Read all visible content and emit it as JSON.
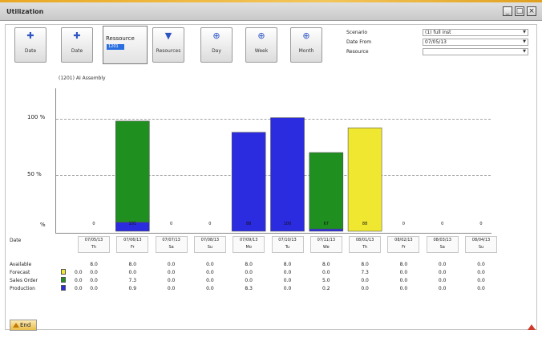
{
  "window": {
    "title": "Utilization",
    "minimize_label": "_",
    "maximize_label": "□",
    "close_label": "×"
  },
  "toolbar": {
    "buttons": [
      {
        "label": "Date",
        "icon": "arrow-up-icon"
      },
      {
        "label": "Date",
        "icon": "arrow-down-icon"
      },
      {
        "label": "Resources",
        "icon": "filter-icon"
      },
      {
        "label": "Day",
        "icon": "zoom-icon"
      },
      {
        "label": "Week",
        "icon": "zoom-icon"
      },
      {
        "label": "Month",
        "icon": "zoom-icon"
      }
    ],
    "resource_button": {
      "label": "Ressource",
      "selected": "1201"
    }
  },
  "params": {
    "scenario": {
      "label": "Scenario",
      "value": "(1) full inst"
    },
    "date_from": {
      "label": "Date From",
      "value": "07/05/13"
    },
    "resource": {
      "label": "Resource",
      "value": ""
    }
  },
  "chart_subtitle": "(1201) AI Assembly",
  "colors": {
    "production": "#2b2be0",
    "sales_order": "#1f8f1f",
    "forecast": "#f0e830",
    "accent": "#e9a823"
  },
  "chart_data": {
    "type": "bar",
    "ylabel_ticks": [
      "100 %",
      "50 %",
      "%"
    ],
    "ylim": [
      0,
      130
    ],
    "categories": [
      "07/05/13",
      "07/06/13",
      "07/07/13",
      "07/08/13",
      "07/09/13",
      "07/10/13",
      "07/11/13",
      "08/01/13",
      "08/02/13",
      "08/03/13",
      "08/04/13"
    ],
    "days": [
      "Th",
      "Fr",
      "Sa",
      "Su",
      "Mo",
      "Tu",
      "We",
      "Th",
      "Fr",
      "Sa",
      "Su"
    ],
    "series": [
      {
        "name": "Production",
        "color": "#2b2be0",
        "values": [
          0,
          8,
          0,
          0,
          88,
          101,
          2,
          0,
          0,
          0,
          0
        ]
      },
      {
        "name": "Sales Order",
        "color": "#1f8f1f",
        "values": [
          0,
          90,
          0,
          0,
          0,
          0,
          68,
          0,
          0,
          0,
          0
        ]
      },
      {
        "name": "Forecast",
        "color": "#f0e830",
        "values": [
          0,
          0,
          0,
          0,
          0,
          0,
          0,
          92,
          0,
          0,
          0
        ]
      }
    ],
    "bar_labels": [
      "0",
      "101",
      "0",
      "0",
      "88",
      "100",
      "67",
      "88",
      "0",
      "0",
      "0"
    ]
  },
  "table": {
    "date_label": "Date",
    "rows": [
      {
        "label": "Available",
        "legend": "",
        "first": "",
        "values": [
          "8.0",
          "8.0",
          "0.0",
          "0.0",
          "8.0",
          "8.0",
          "8.0",
          "8.0",
          "8.0",
          "0.0",
          "0.0"
        ]
      },
      {
        "label": "Forecast",
        "legend": "#f0e830",
        "first": "0.0",
        "values": [
          "0.0",
          "0.0",
          "0.0",
          "0.0",
          "0.0",
          "0.0",
          "0.0",
          "7.3",
          "0.0",
          "0.0",
          "0.0"
        ]
      },
      {
        "label": "Sales Order",
        "legend": "#1f8f1f",
        "first": "0.0",
        "values": [
          "0.0",
          "7.3",
          "0.0",
          "0.0",
          "0.0",
          "0.0",
          "5.0",
          "0.0",
          "0.0",
          "0.0",
          "0.0"
        ]
      },
      {
        "label": "Production",
        "legend": "#2b2be0",
        "first": "0.0",
        "values": [
          "0.0",
          "0.9",
          "0.0",
          "0.0",
          "8.3",
          "0.0",
          "0.2",
          "0.0",
          "0.0",
          "0.0",
          "0.0"
        ]
      }
    ]
  },
  "footer": {
    "end_label": "End"
  }
}
